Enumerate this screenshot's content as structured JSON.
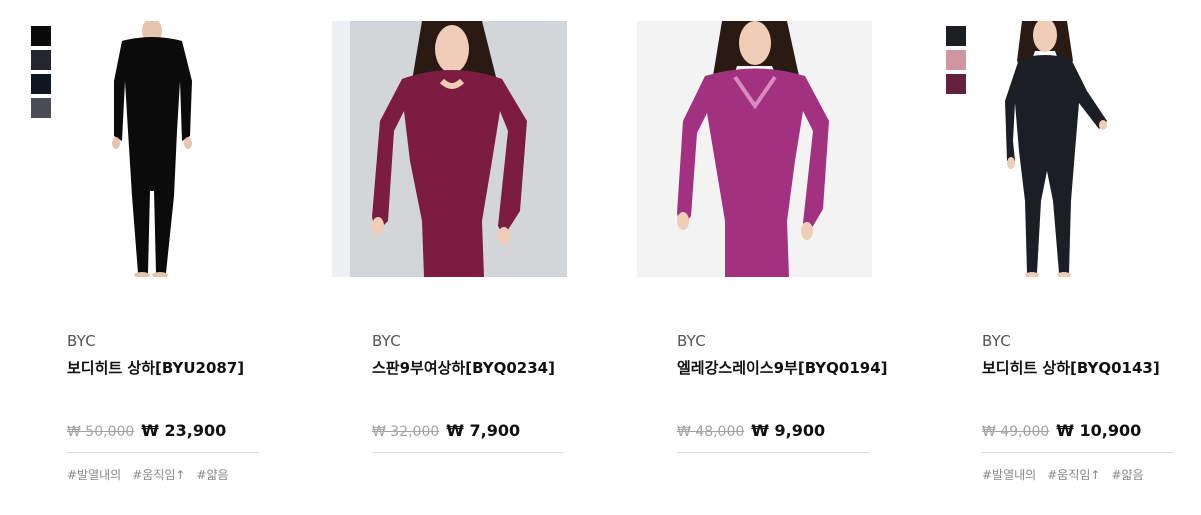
{
  "products": [
    {
      "brand": "BYC",
      "title": "보디히트 상하[BYU2087]",
      "original_price": "₩ 50,000",
      "sale_price": "₩ 23,900",
      "tags": [
        "#발열내의",
        "#움직임↑",
        "#얇음"
      ],
      "swatches": [
        "#0a0a0a",
        "#23262e",
        "#0e1721",
        "#4a4c55"
      ],
      "photo_colors": {
        "bg": "#ffffff",
        "garment": "#0b0b0c",
        "skin": "#e7c4ad"
      }
    },
    {
      "brand": "BYC",
      "title": "스판9부여상하[BYQ0234]",
      "original_price": "₩ 32,000",
      "sale_price": "₩ 7,900",
      "tags": [],
      "swatches": [],
      "photo_colors": {
        "bg": "#d2d6d9",
        "garment": "#7b1c40",
        "skin": "#f0cdb6"
      }
    },
    {
      "brand": "BYC",
      "title": "엘레강스레이스9부[BYQ0194]",
      "original_price": "₩ 48,000",
      "sale_price": "₩ 9,900",
      "tags": [],
      "swatches": [],
      "photo_colors": {
        "bg": "#f3f3f3",
        "garment": "#a2317f",
        "skin": "#f0cdb6"
      }
    },
    {
      "brand": "BYC",
      "title": "보디히트 상하[BYQ0143]",
      "original_price": "₩ 49,000",
      "sale_price": "₩ 10,900",
      "tags": [
        "#발열내의",
        "#움직임↑",
        "#얇음"
      ],
      "swatches": [
        "#1b1f22",
        "#d3959f",
        "#63213e"
      ],
      "photo_colors": {
        "bg": "#ffffff",
        "garment": "#1c1e25",
        "skin": "#f0cdb6"
      }
    }
  ]
}
